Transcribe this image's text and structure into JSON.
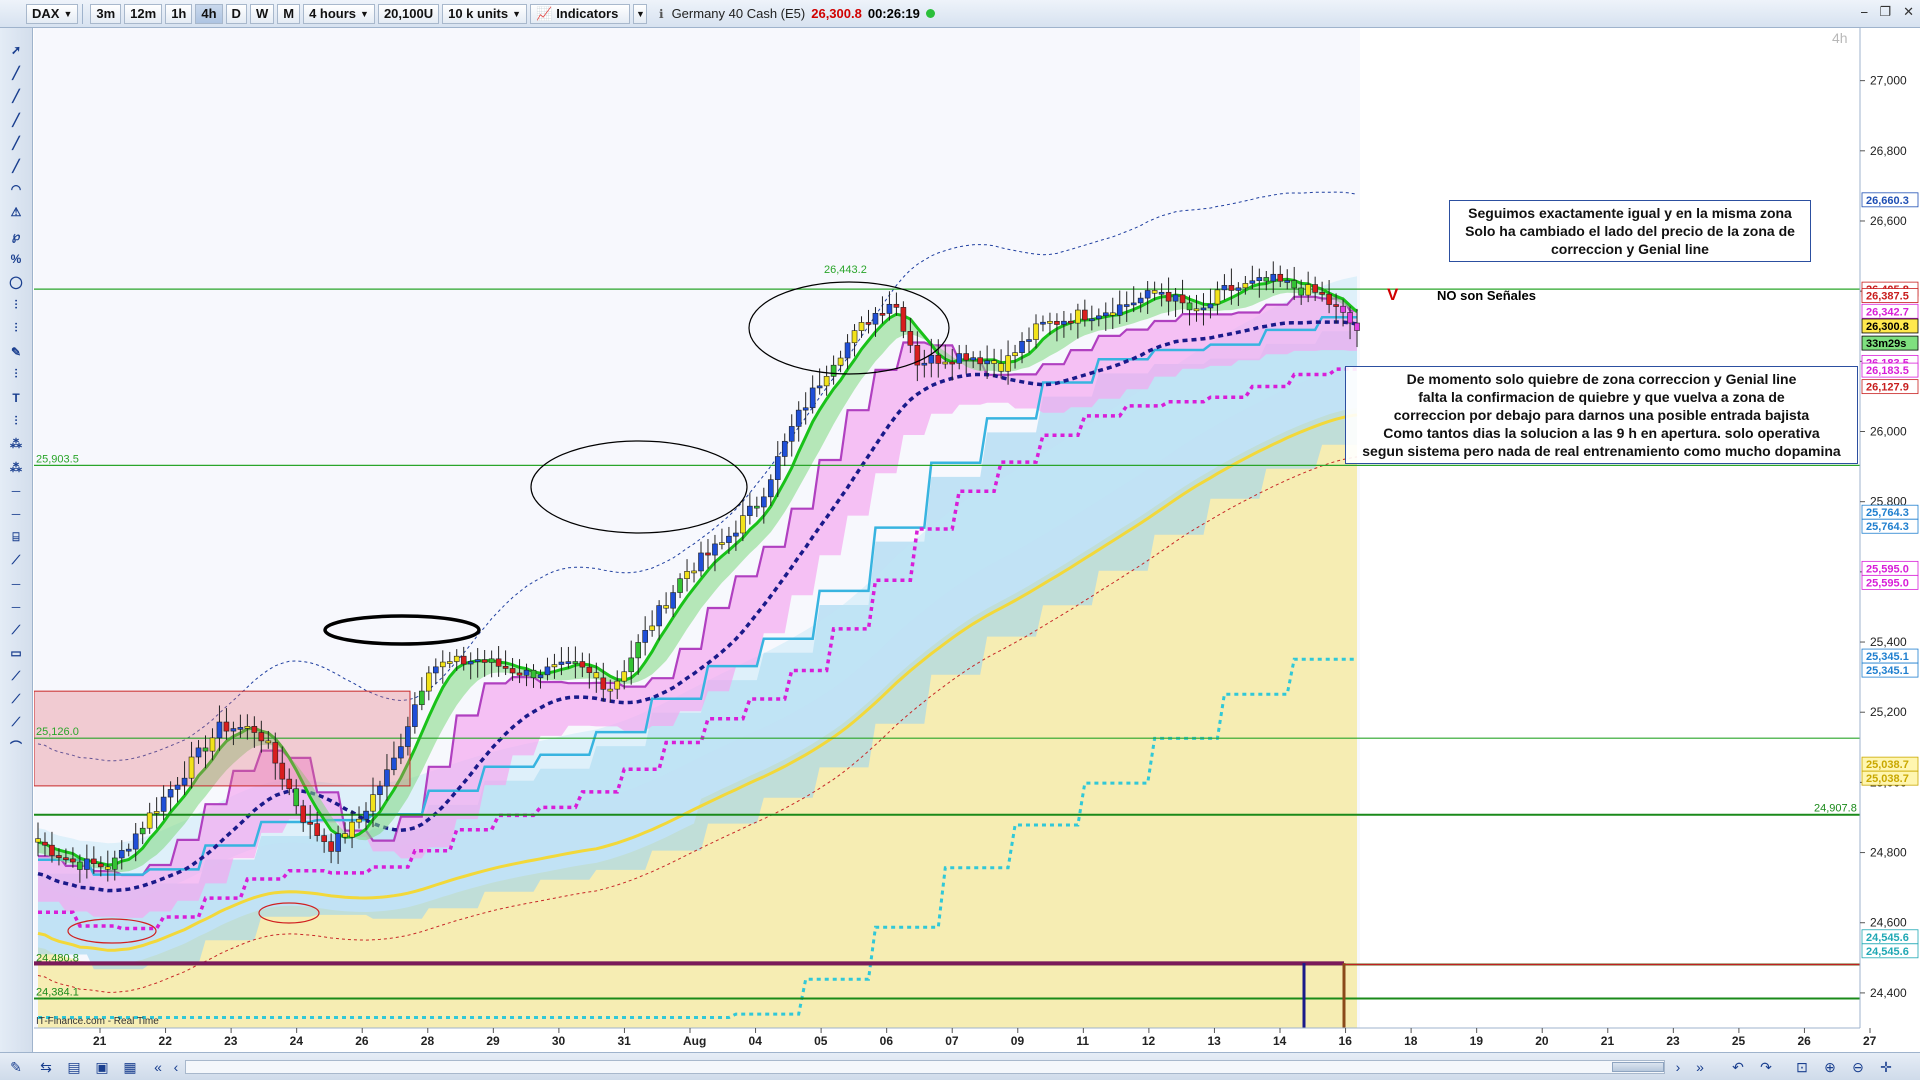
{
  "toolbar": {
    "symbol": "DAX",
    "timeframes": [
      "3m",
      "12m",
      "1h",
      "4h",
      "D",
      "W",
      "M"
    ],
    "active_timeframe": "4h",
    "period_select": "4 hours",
    "units_value": "20,100U",
    "units_select": "10 k units",
    "indicators_label": "Indicators",
    "instrument_title": "Germany 40 Cash (E5)",
    "price": "26,300.8",
    "time_to_close": "00:26:19"
  },
  "chart": {
    "period_label": "4h",
    "footer_text": "IT-Finance.com - Real Time",
    "y_axis_ticks": [
      "27,000",
      "26,800",
      "26,600",
      "26,400",
      "26,200",
      "26,000",
      "25,800",
      "25,600",
      "25,400",
      "25,200",
      "25,000",
      "24,800",
      "24,600",
      "24,400"
    ],
    "y_axis_values": [
      27000,
      26800,
      26600,
      26400,
      26200,
      26000,
      25800,
      25600,
      25400,
      25200,
      25000,
      24800,
      24600,
      24400
    ],
    "y_range": [
      24300,
      27150
    ],
    "x_axis_labels": [
      "21",
      "22",
      "23",
      "24",
      "26",
      "28",
      "29",
      "30",
      "31",
      "Aug",
      "04",
      "05",
      "06",
      "07",
      "09",
      "11",
      "12",
      "13",
      "14",
      "16",
      "18",
      "19",
      "20",
      "21",
      "23",
      "25",
      "26",
      "27"
    ],
    "price_tags": [
      {
        "text": "26,660.3",
        "value": 26660.3,
        "color": "#1f4fb4",
        "bg": "#ffffff"
      },
      {
        "text": "26,405.8",
        "value": 26405.8,
        "color": "#c81e1e",
        "bg": "#ffffff"
      },
      {
        "text": "26,387.5",
        "value": 26387.5,
        "color": "#c81e1e",
        "bg": "#ffffff"
      },
      {
        "text": "26,342.7",
        "value": 26342.7,
        "color": "#d81ed8",
        "bg": "#ffffff"
      },
      {
        "text": "26,300.8",
        "value": 26300.8,
        "color": "#000000",
        "bg": "#ffe94d"
      },
      {
        "text": "33m29s",
        "value": 26252,
        "color": "#000000",
        "bg": "#7fe07f"
      },
      {
        "text": "26,183.5",
        "value": 26197,
        "color": "#d81ed8",
        "bg": "#ffffff"
      },
      {
        "text": "26,183.5",
        "value": 26175,
        "color": "#d81ed8",
        "bg": "#ffffff"
      },
      {
        "text": "26,127.9",
        "value": 26127.9,
        "color": "#c81e1e",
        "bg": "#ffffff"
      },
      {
        "text": "25,764.3",
        "value": 25770,
        "color": "#1f7fcf",
        "bg": "#ffffff"
      },
      {
        "text": "25,764.3",
        "value": 25730,
        "color": "#1f7fcf",
        "bg": "#ffffff"
      },
      {
        "text": "25,595.0",
        "value": 25610,
        "color": "#d81ed8",
        "bg": "#ffffff"
      },
      {
        "text": "25,595.0",
        "value": 25570,
        "color": "#d81ed8",
        "bg": "#ffffff"
      },
      {
        "text": "25,345.1",
        "value": 25360,
        "color": "#1f7fcf",
        "bg": "#ffffff"
      },
      {
        "text": "25,345.1",
        "value": 25320,
        "color": "#1f7fcf",
        "bg": "#ffffff"
      },
      {
        "text": "25,038.7",
        "value": 25052,
        "color": "#c9a800",
        "bg": "#fff6b0"
      },
      {
        "text": "25,038.7",
        "value": 25012,
        "color": "#c9a800",
        "bg": "#fff6b0"
      },
      {
        "text": "24,545.6",
        "value": 24560,
        "color": "#1fa8b4",
        "bg": "#ffffff"
      },
      {
        "text": "24,545.6",
        "value": 24520,
        "color": "#1fa8b4",
        "bg": "#ffffff"
      }
    ],
    "level_lines": [
      {
        "text": "25,903.5",
        "value": 25903.5,
        "color": "#2aa52a"
      },
      {
        "text": "25,126.0",
        "value": 25126.0,
        "color": "#2aa52a"
      },
      {
        "text": "24,907.8",
        "value": 24907.8,
        "color": "#1a8a1a"
      },
      {
        "text": "24,480.8",
        "value": 24480.8,
        "color": "#1a8a1a"
      },
      {
        "text": "24,384.1",
        "value": 24384.1,
        "color": "#1a8a1a"
      },
      {
        "text": "26,443.2",
        "value": 26443.2,
        "color": "#2aa52a"
      }
    ]
  },
  "annotations": {
    "note1": "Seguimos exactamente igual y en la misma zona\nSolo ha cambiado el lado del precio de la zona de\ncorreccion y Genial line",
    "note2": "De momento solo quiebre de zona correccion y Genial line\nfalta la confirmacion de quiebre y que vuelva a zona de\ncorreccion por debajo para darnos una posible entrada bajista\nComo tantos dias la solucion a las 9 h en apertura. solo operativa\nsegun sistema pero nada de real entrenamiento como mucho dopamina",
    "no_senales": "NO son Señales",
    "v_mark": "V"
  },
  "colors": {
    "bull_candle": "#1f4fd8",
    "bear_candle": "#d81e1e",
    "yellow_candle": "#f2e21a",
    "green_candle": "#33c233",
    "magenta_candle": "#e040e0",
    "genial_line": "#19c219",
    "trend_dotted": "#1a1a8a",
    "cloud_pink": "#f4a8f0",
    "cloud_blue": "#9cd4f0",
    "cloud_yellow": "#f6ea9a"
  }
}
